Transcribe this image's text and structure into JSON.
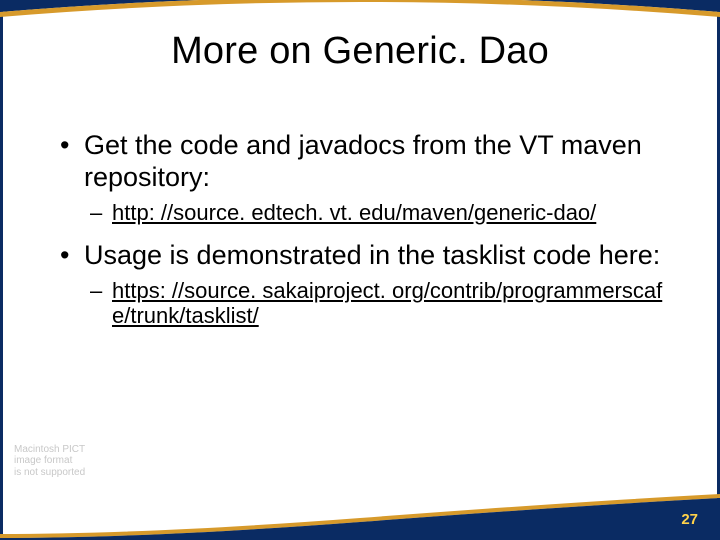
{
  "title": "More on Generic. Dao",
  "bullets": [
    {
      "text": "Get the code and javadocs from the VT maven repository:",
      "sub": "http: //source. edtech. vt. edu/maven/generic-dao/"
    },
    {
      "text": "Usage is demonstrated in the tasklist code here:",
      "sub": "https: //source. sakaiproject. org/contrib/programmerscafe/trunk/tasklist/"
    }
  ],
  "placeholder": "Macintosh PICT\nimage format\nis not supported",
  "pageNumber": "27",
  "colors": {
    "navy": "#0a2b63",
    "gold": "#d79a2b",
    "pagenum": "#ffd24a"
  }
}
